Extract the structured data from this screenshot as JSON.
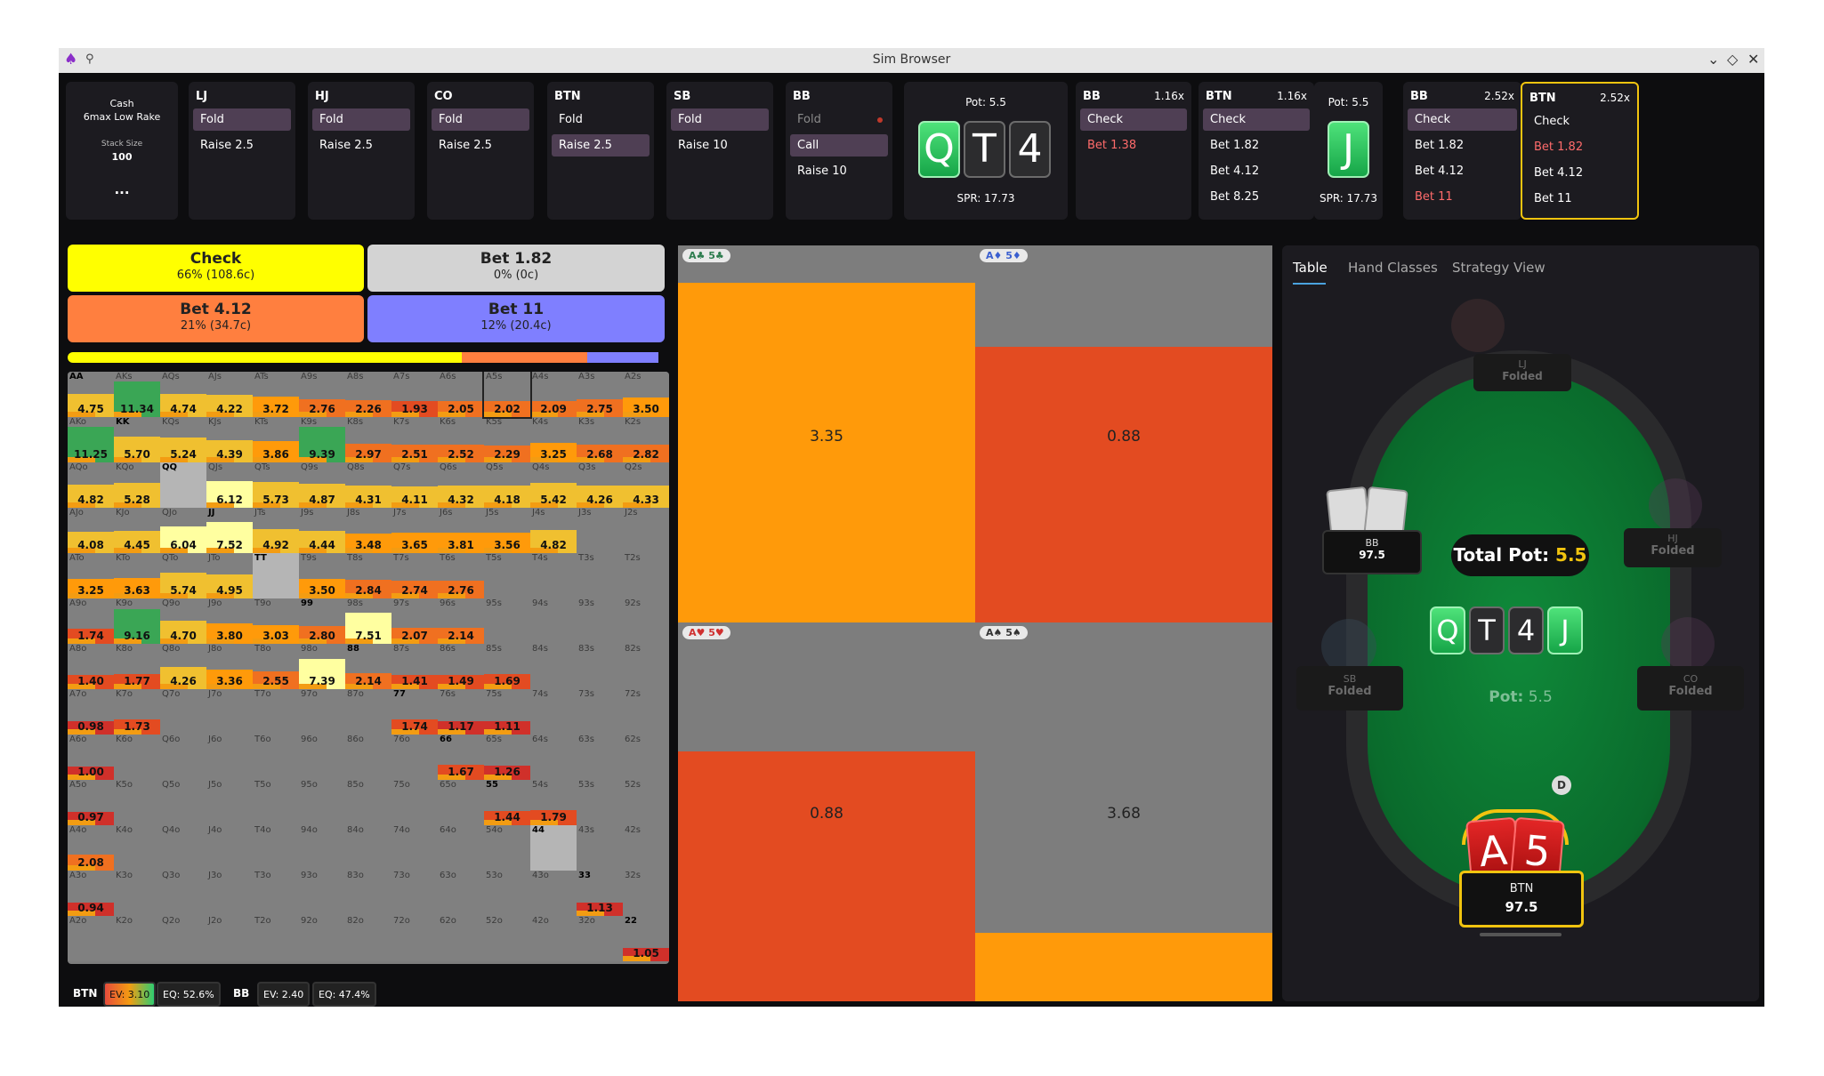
{
  "window": {
    "title": "Sim Browser",
    "logo_icon": "poker-spade-logo-icon",
    "pin_icon": "pin-icon"
  },
  "game_info": {
    "mode": "Cash",
    "format": "6max Low Rake",
    "stack_label": "Stack Size",
    "stack_value": "100",
    "more": "..."
  },
  "preflop_nodes": [
    {
      "id": "LJ",
      "options": [
        {
          "label": "Fold",
          "selected": true
        },
        {
          "label": "Raise 2.5",
          "selected": false
        }
      ]
    },
    {
      "id": "HJ",
      "options": [
        {
          "label": "Fold",
          "selected": true
        },
        {
          "label": "Raise 2.5",
          "selected": false
        }
      ]
    },
    {
      "id": "CO",
      "options": [
        {
          "label": "Fold",
          "selected": true
        },
        {
          "label": "Raise 2.5",
          "selected": false
        }
      ]
    },
    {
      "id": "BTN",
      "options": [
        {
          "label": "Fold",
          "selected": false
        },
        {
          "label": "Raise 2.5",
          "selected": true
        }
      ]
    },
    {
      "id": "SB",
      "options": [
        {
          "label": "Fold",
          "selected": true
        },
        {
          "label": "Raise 10",
          "selected": false
        }
      ]
    },
    {
      "id": "BB",
      "options": [
        {
          "label": "Fold",
          "selected": false,
          "dim": true
        },
        {
          "label": "Call",
          "selected": true
        },
        {
          "label": "Raise 10",
          "selected": false
        }
      ]
    }
  ],
  "flop": {
    "pot": "Pot: 5.5",
    "spr": "SPR: 17.73",
    "cards": [
      "Q",
      "T",
      "4"
    ]
  },
  "flop_nodes": [
    {
      "id": "BB",
      "mult": "1.16x",
      "options": [
        {
          "label": "Check",
          "selected": true
        },
        {
          "label": "Bet 1.38",
          "selected": false,
          "red": true
        }
      ]
    },
    {
      "id": "BTN",
      "mult": "1.16x",
      "options": [
        {
          "label": "Check",
          "selected": true
        },
        {
          "label": "Bet 1.82",
          "selected": false
        },
        {
          "label": "Bet 4.12",
          "selected": false
        },
        {
          "label": "Bet 8.25",
          "selected": false
        }
      ]
    }
  ],
  "turn": {
    "pot": "Pot: 5.5",
    "spr": "SPR: 17.73",
    "card": "J"
  },
  "turn_nodes": [
    {
      "id": "BB",
      "mult": "2.52x",
      "options": [
        {
          "label": "Check",
          "selected": true
        },
        {
          "label": "Bet 1.82",
          "selected": false
        },
        {
          "label": "Bet 4.12",
          "selected": false
        },
        {
          "label": "Bet 11",
          "selected": false,
          "red": true
        }
      ]
    },
    {
      "id": "BTN",
      "mult": "2.52x",
      "active": true,
      "options": [
        {
          "label": "Check",
          "selected": false
        },
        {
          "label": "Bet 1.82",
          "selected": false,
          "red": true
        },
        {
          "label": "Bet 4.12",
          "selected": false
        },
        {
          "label": "Bet 11",
          "selected": false
        }
      ]
    }
  ],
  "actions": [
    {
      "label": "Check",
      "pct": "66% (108.6c)",
      "color": "#ffff00"
    },
    {
      "label": "Bet 1.82",
      "pct": "0% (0c)",
      "color": "#d3d3d3"
    },
    {
      "label": "Bet 4.12",
      "pct": "21% (34.7c)",
      "color": "#ff7f3f"
    },
    {
      "label": "Bet 11",
      "pct": "12% (20.4c)",
      "color": "#7f7fff"
    }
  ],
  "frequencies": {
    "check": 0.66,
    "bet182": 0.0,
    "bet412": 0.21,
    "bet11": 0.12
  },
  "hand_grid": {
    "ranks": [
      "A",
      "K",
      "Q",
      "J",
      "T",
      "9",
      "8",
      "7",
      "6",
      "5",
      "4",
      "3",
      "2"
    ],
    "ev": [
      [
        "4.75",
        "11.34",
        "4.74",
        "4.22",
        "3.72",
        "2.76",
        "2.26",
        "1.93",
        "2.05",
        "2.02",
        "2.09",
        "2.75",
        "3.50"
      ],
      [
        "11.25",
        "5.70",
        "5.24",
        "4.39",
        "3.86",
        "9.39",
        "2.97",
        "2.51",
        "2.52",
        "2.29",
        "3.25",
        "2.68",
        "2.82"
      ],
      [
        "4.82",
        "5.28",
        "",
        "6.12",
        "5.73",
        "4.87",
        "4.31",
        "4.11",
        "4.32",
        "4.18",
        "5.42",
        "4.26",
        "4.33"
      ],
      [
        "4.08",
        "4.45",
        "6.04",
        "7.52",
        "4.92",
        "4.44",
        "3.48",
        "3.65",
        "3.81",
        "3.56",
        "4.82",
        "",
        ""
      ],
      [
        "3.25",
        "3.63",
        "5.74",
        "4.95",
        "",
        "3.50",
        "2.84",
        "2.74",
        "2.76",
        "",
        "",
        "",
        ""
      ],
      [
        "1.74",
        "9.16",
        "4.70",
        "3.80",
        "3.03",
        "2.80",
        "7.51",
        "2.07",
        "2.14",
        "",
        "",
        "",
        ""
      ],
      [
        "1.40",
        "1.77",
        "4.26",
        "3.36",
        "2.55",
        "7.39",
        "2.14",
        "1.41",
        "1.49",
        "1.69",
        "",
        "",
        ""
      ],
      [
        "0.98",
        "1.73",
        "",
        "",
        "",
        "",
        "",
        "1.74",
        "1.17",
        "1.11",
        "",
        "",
        ""
      ],
      [
        "1.00",
        "",
        "",
        "",
        "",
        "",
        "",
        "",
        "1.67",
        "1.26",
        "",
        "",
        ""
      ],
      [
        "0.97",
        "",
        "",
        "",
        "",
        "",
        "",
        "",
        "",
        "1.44",
        "1.79",
        "",
        ""
      ],
      [
        "2.08",
        "",
        "",
        "",
        "",
        "",
        "",
        "",
        "",
        "",
        "",
        "",
        ""
      ],
      [
        "0.94",
        "",
        "",
        "",
        "",
        "",
        "",
        "",
        "",
        "",
        "",
        "1.13",
        ""
      ],
      [
        "",
        "",
        "",
        "",
        "",
        "",
        "",
        "",
        "",
        "",
        "",
        "",
        "1.05"
      ]
    ],
    "selected": "A5s"
  },
  "combos": [
    {
      "label": "A♣ 5♣",
      "ev": "3.35",
      "top": "#7d7d7d",
      "bottom": "#ff9a0a",
      "split": 0.1
    },
    {
      "label": "A♦ 5♦",
      "ev": "0.88",
      "top": "#7d7d7d",
      "bottom": "#e34b21",
      "split": 0.27
    },
    {
      "label": "A♥ 5♥",
      "ev": "0.88",
      "top": "#7d7d7d",
      "bottom": "#e34b21",
      "split": 0.34
    },
    {
      "label": "A♠ 5♠",
      "ev": "3.68",
      "top": "#7d7d7d",
      "bottom": "#ff9a0a",
      "split": 0.82
    }
  ],
  "table_view": {
    "tabs": [
      "Table",
      "Hand Classes",
      "Strategy View"
    ],
    "total_pot_label": "Total Pot:",
    "total_pot_value": "5.5",
    "pot_label": "Pot:",
    "pot_value": "5.5",
    "board": [
      "Q",
      "T",
      "4",
      "J"
    ],
    "seats": [
      {
        "pos": "LJ",
        "status": "Folded"
      },
      {
        "pos": "HJ",
        "status": "Folded"
      },
      {
        "pos": "CO",
        "status": "Folded"
      },
      {
        "pos": "SB",
        "status": "Folded"
      },
      {
        "pos": "BB",
        "stack": "97.5"
      },
      {
        "pos": "BTN",
        "stack": "97.5"
      }
    ],
    "hero_cards": [
      "A",
      "5"
    ],
    "dealer": "D"
  },
  "bottom_bar": {
    "btn_pos": "BTN",
    "btn_ev": "EV: 3.10",
    "btn_eq": "EQ: 52.6%",
    "bb_pos": "BB",
    "bb_ev": "EV: 2.40",
    "bb_eq": "EQ: 47.4%"
  }
}
